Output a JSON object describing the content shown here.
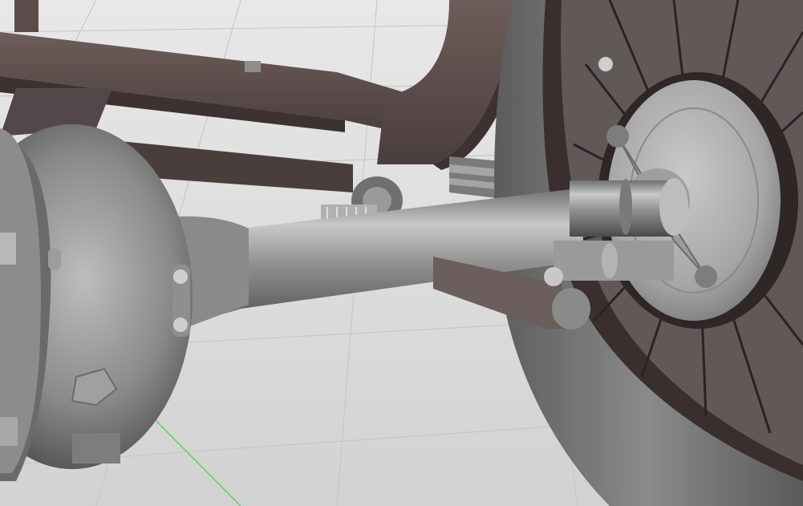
{
  "viewport": {
    "background_color": "#dcdcdc",
    "grid_color": "#c4c4c4",
    "grid_axis_color": "#5fd05f",
    "frame_color": "#5a4c4a",
    "frame_shadow_color": "#3d3231",
    "metal_light": "#b9b9b9",
    "metal_mid": "#8e8e8e",
    "metal_dark": "#5b5b5b",
    "tire_color": "#6f6f6f",
    "spoke_color": "#2b2323"
  }
}
